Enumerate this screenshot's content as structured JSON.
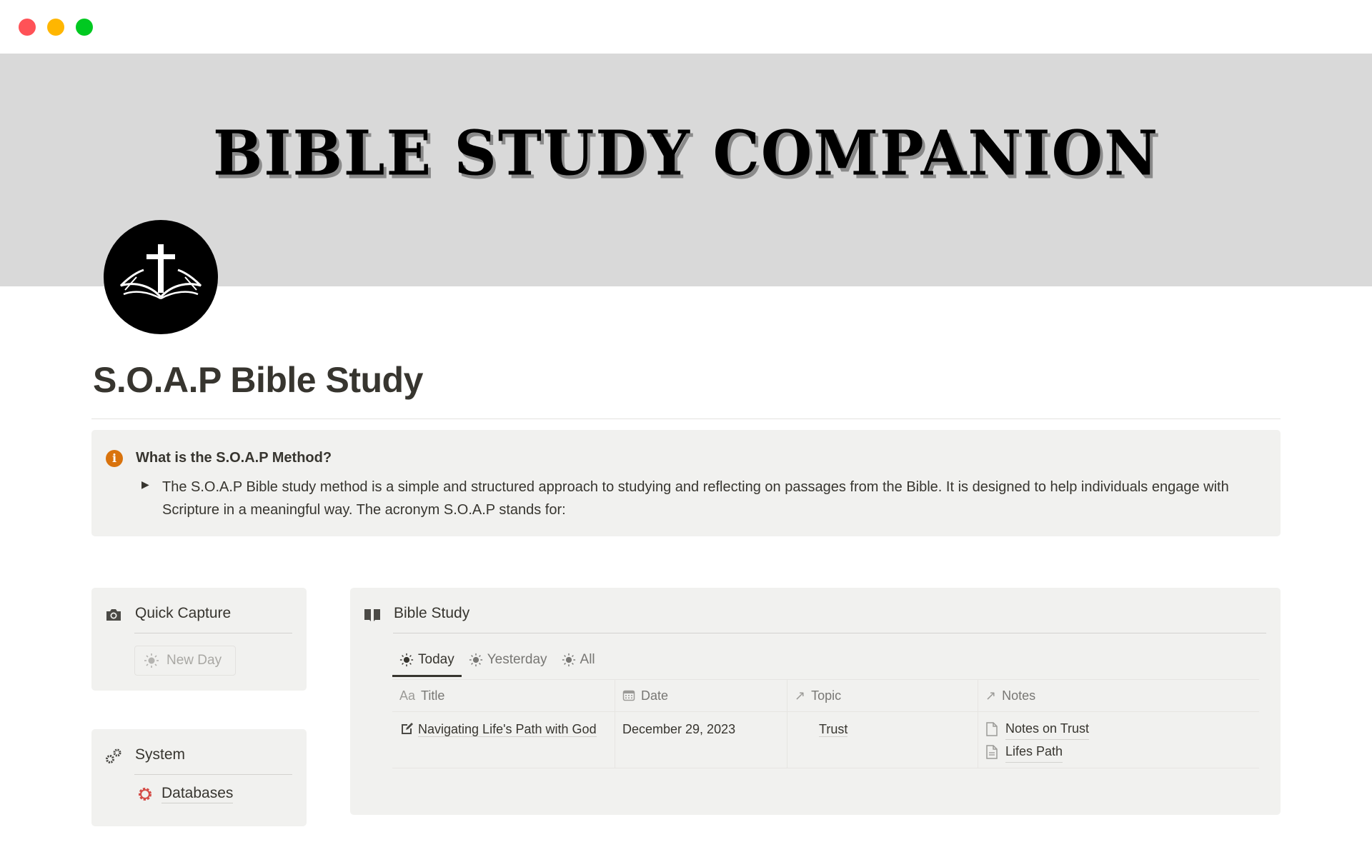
{
  "window": {
    "traffic_lights": [
      "close",
      "minimize",
      "maximize"
    ]
  },
  "banner": {
    "title": "BIBLE STUDY COMPANION",
    "background": "#d9d9d9"
  },
  "page": {
    "icon": "cross-open-bible-icon",
    "title": "S.O.A.P Bible Study"
  },
  "callout": {
    "icon": "info-icon",
    "icon_color": "#d9730d",
    "heading": "What is the S.O.A.P Method?",
    "toggle_text": "The S.O.A.P Bible study method is a simple and structured approach to studying and reflecting on passages from the Bible. It is designed to help individuals engage with Scripture in a meaningful way. The acronym S.O.A.P stands for:"
  },
  "quick_capture": {
    "icon": "camera-icon",
    "title": "Quick Capture",
    "button_label": "New Day",
    "button_icon": "sun-icon"
  },
  "system": {
    "icon": "gears-icon",
    "title": "System",
    "link_label": "Databases",
    "link_icon": "gear-icon",
    "link_icon_color": "#d44c47"
  },
  "bible_study": {
    "icon": "book-icon",
    "title": "Bible Study",
    "tabs": [
      {
        "label": "Today",
        "icon": "sun-icon",
        "active": true
      },
      {
        "label": "Yesterday",
        "icon": "sun-icon",
        "active": false
      },
      {
        "label": "All",
        "icon": "sun-icon",
        "active": false
      }
    ],
    "columns": [
      {
        "label": "Title",
        "icon": "Aa"
      },
      {
        "label": "Date",
        "icon": "calendar-icon"
      },
      {
        "label": "Topic",
        "icon": "relation-arrow-icon"
      },
      {
        "label": "Notes",
        "icon": "relation-arrow-icon"
      }
    ],
    "rows": [
      {
        "title": "Navigating Life's Path with God",
        "date": "December 29, 2023",
        "topic": "Trust",
        "notes": [
          "Notes on Trust",
          "Lifes Path"
        ]
      }
    ]
  }
}
